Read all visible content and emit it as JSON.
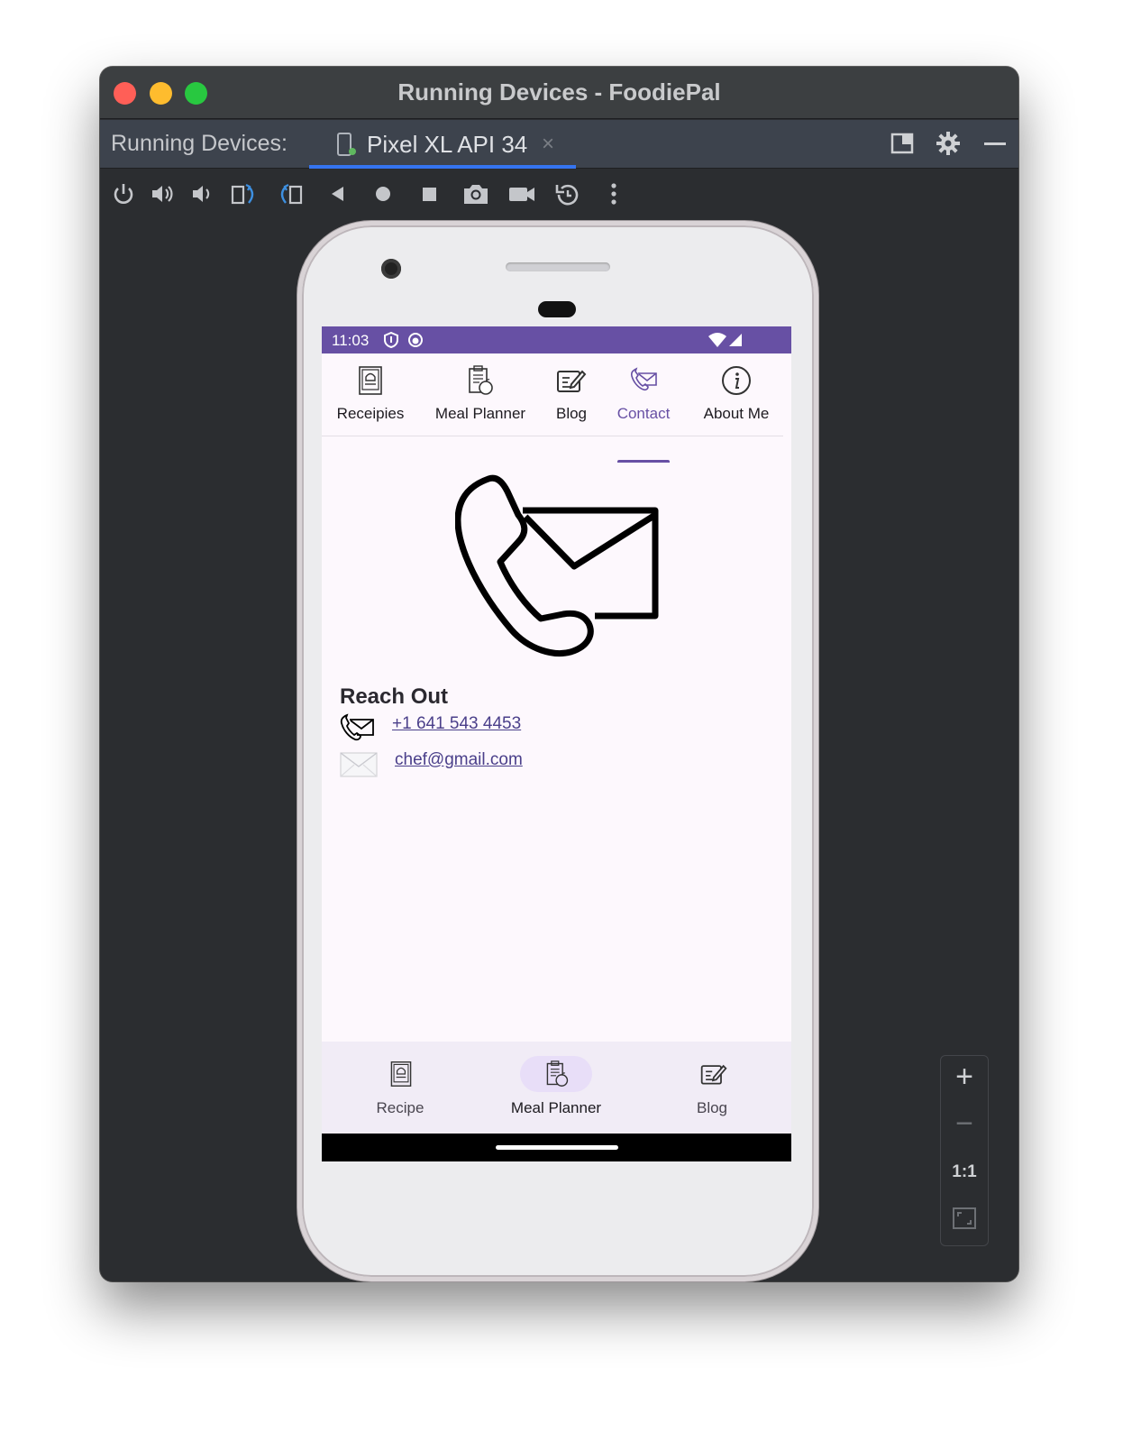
{
  "window": {
    "title": "Running Devices - FoodiePal"
  },
  "tabbar": {
    "prefix": "Running Devices:",
    "device_tab": "Pixel XL API 34",
    "close_glyph": "×"
  },
  "toolbar": {
    "buttons": [
      "power-icon",
      "volume-up-icon",
      "volume-down-icon",
      "rotate-left-icon",
      "rotate-right-icon",
      "back-icon",
      "home-icon",
      "overview-icon",
      "screenshot-icon",
      "screen-record-icon",
      "reset-icon",
      "more-icon"
    ]
  },
  "zoom": {
    "plus": "+",
    "minus": "−",
    "one_to_one": "1:1"
  },
  "app": {
    "status": {
      "time": "11:03"
    },
    "top_tabs": [
      {
        "label": "Receipies",
        "icon": "recipe-book-icon"
      },
      {
        "label": "Meal Planner",
        "icon": "meal-planner-icon"
      },
      {
        "label": "Blog",
        "icon": "blog-edit-icon"
      },
      {
        "label": "Contact",
        "icon": "contact-icon",
        "active": true
      },
      {
        "label": "About Me",
        "icon": "info-icon"
      }
    ],
    "contact": {
      "heading": "Reach Out",
      "phone": "+1 641 543 4453",
      "email": "chef@gmail.com"
    },
    "bottom_nav": [
      {
        "label": "Recipe",
        "icon": "recipe-book-icon"
      },
      {
        "label": "Meal Planner",
        "icon": "meal-planner-icon",
        "active": true
      },
      {
        "label": "Blog",
        "icon": "blog-edit-icon"
      }
    ]
  },
  "colors": {
    "primary": "#6750a4",
    "link": "#4a3f8a",
    "active_pill": "#e8def8",
    "bottom_nav_bg": "#f1ecf6"
  }
}
